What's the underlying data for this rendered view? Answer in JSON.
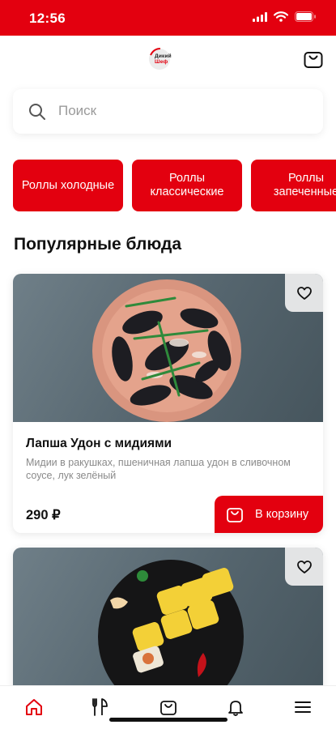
{
  "status_bar": {
    "time": "12:56"
  },
  "header": {
    "logo_line1": "Дикий",
    "logo_line2": "Шеф"
  },
  "search": {
    "placeholder": "Поиск",
    "value": ""
  },
  "categories": [
    {
      "label": "Роллы холодные"
    },
    {
      "label": "Роллы классические"
    },
    {
      "label": "Роллы запеченные"
    }
  ],
  "section_title": "Популярные блюда",
  "products": [
    {
      "title": "Лапша Удон с мидиями",
      "description": "Мидии в ракушках, пшеничная лапша удон в сливочном соусе, лук зелёный",
      "price": "290 ₽",
      "add_label": "В корзину"
    },
    {
      "title": "",
      "description": "",
      "price": "",
      "add_label": ""
    }
  ],
  "colors": {
    "brand": "#e3000f",
    "background": "#ffffff",
    "muted_text": "#8a8a8a"
  },
  "icons": [
    "wifi-icon",
    "battery-icon",
    "signal-icon",
    "cart-icon",
    "search-icon",
    "heart-icon",
    "home-icon",
    "menu-fork-icon",
    "bell-icon",
    "hamburger-icon"
  ]
}
